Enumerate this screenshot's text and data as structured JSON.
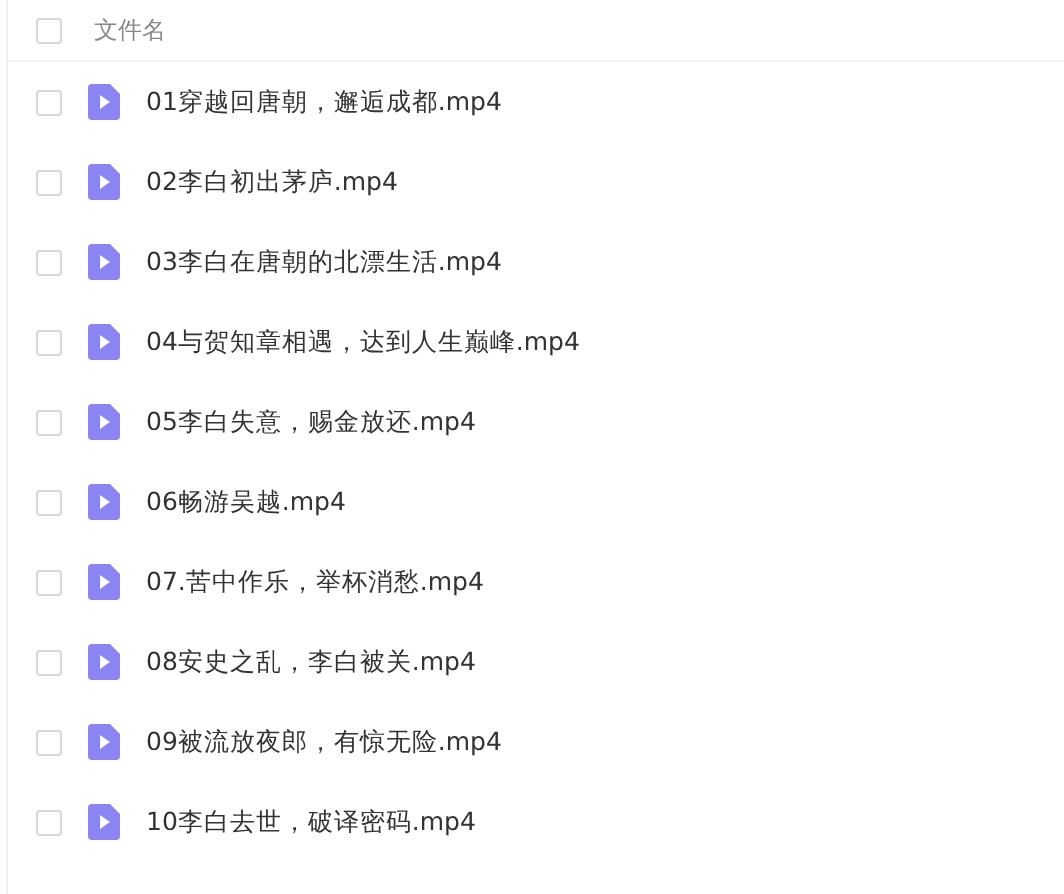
{
  "header": {
    "select_all": {
      "checked": false
    },
    "column_1": "文件名"
  },
  "files": [
    {
      "name": "01穿越回唐朝，邂逅成都.mp4",
      "checked": false
    },
    {
      "name": "02李白初出茅庐.mp4",
      "checked": false
    },
    {
      "name": "03李白在唐朝的北漂生活.mp4",
      "checked": false
    },
    {
      "name": "04与贺知章相遇，达到人生巅峰.mp4",
      "checked": false
    },
    {
      "name": "05李白失意，赐金放还.mp4",
      "checked": false
    },
    {
      "name": "06畅游吴越.mp4",
      "checked": false
    },
    {
      "name": "07.苦中作乐，举杯消愁.mp4",
      "checked": false
    },
    {
      "name": "08安史之乱，李白被关.mp4",
      "checked": false
    },
    {
      "name": "09被流放夜郎，有惊无险.mp4",
      "checked": false
    },
    {
      "name": "10李白去世，破译密码.mp4",
      "checked": false
    }
  ]
}
